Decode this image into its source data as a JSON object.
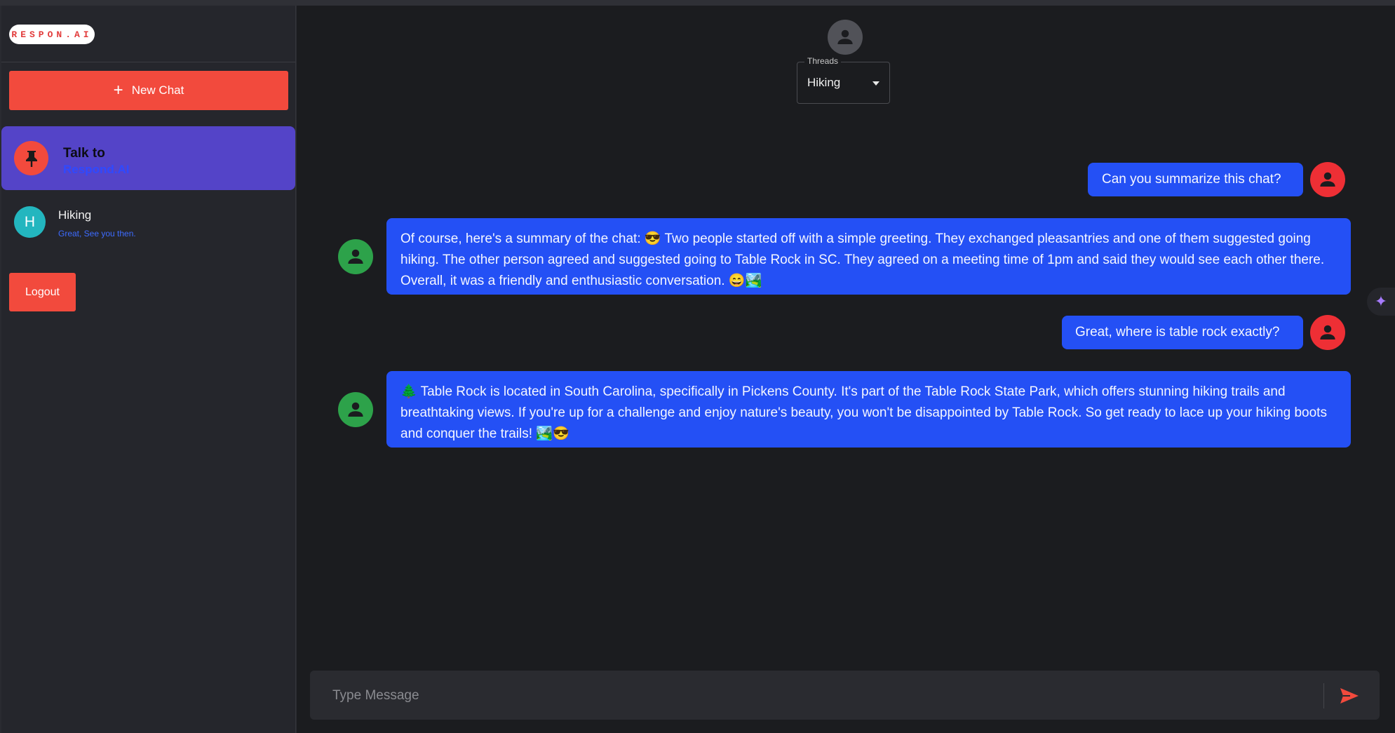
{
  "brand": {
    "logo_text": "RESPON.AI"
  },
  "sidebar": {
    "new_chat_label": "New Chat",
    "pinned_item": {
      "title": "Talk to",
      "subtitle": "Respond.AI"
    },
    "items": [
      {
        "initial": "H",
        "title": "Hiking",
        "preview": "Great, See you then."
      }
    ],
    "logout_label": "Logout"
  },
  "header": {
    "threads_label": "Threads",
    "threads_value": "Hiking"
  },
  "messages": [
    {
      "role": "user",
      "text": "Can you summarize this chat?"
    },
    {
      "role": "assistant",
      "text": "Of course, here's a summary of the chat: 😎 Two people started off with a simple greeting. They exchanged pleasantries and one of them suggested going hiking. The other person agreed and suggested going to Table Rock in SC. They agreed on a meeting time of 1pm and said they would see each other there. Overall, it was a friendly and enthusiastic conversation. 😄🏞️"
    },
    {
      "role": "user",
      "text": "Great, where is table rock exactly?"
    },
    {
      "role": "assistant",
      "text": "🌲 Table Rock is located in South Carolina, specifically in Pickens County. It's part of the Table Rock State Park, which offers stunning hiking trails and breathtaking views. If you're up for a challenge and enjoy nature's beauty, you won't be disappointed by Table Rock. So get ready to lace up your hiking boots and conquer the trails! 🏞️😎"
    }
  ],
  "composer": {
    "placeholder": "Type Message"
  },
  "colors": {
    "accent_red": "#f24a3d",
    "bubble_blue": "#2450f5",
    "pinned_purple": "#5444c8",
    "bot_green": "#2da24a",
    "avatar_teal": "#23b6bf"
  }
}
